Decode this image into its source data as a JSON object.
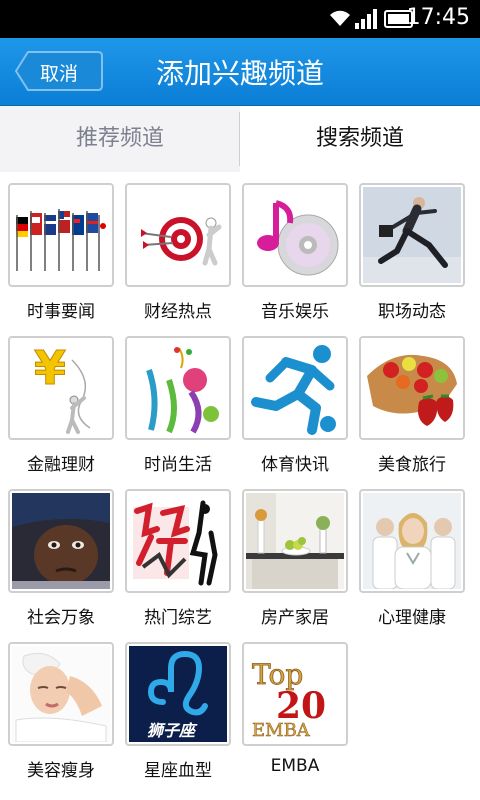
{
  "status_bar": {
    "time": "17:45",
    "icons": [
      "wifi-icon",
      "signal-icon",
      "battery-icon"
    ]
  },
  "header": {
    "back_label": "取消",
    "title": "添加兴趣频道"
  },
  "tabs": [
    {
      "label": "推荐频道",
      "selected": false
    },
    {
      "label": "搜索频道",
      "selected": true
    }
  ],
  "channels": [
    {
      "label": "时事要闻",
      "image": "flags-image"
    },
    {
      "label": "财经热点",
      "image": "target-image"
    },
    {
      "label": "音乐娱乐",
      "image": "music-cd-image"
    },
    {
      "label": "职场动态",
      "image": "businessman-jump-image"
    },
    {
      "label": "金融理财",
      "image": "yuan-sign-image"
    },
    {
      "label": "时尚生活",
      "image": "fashion-illustration-image"
    },
    {
      "label": "体育快讯",
      "image": "runner-icon-image"
    },
    {
      "label": "美食旅行",
      "image": "strawberry-cake-image"
    },
    {
      "label": "社会万象",
      "image": "child-face-image"
    },
    {
      "label": "热门综艺",
      "image": "variety-show-logo-image"
    },
    {
      "label": "房产家居",
      "image": "interior-image"
    },
    {
      "label": "心理健康",
      "image": "doctors-image"
    },
    {
      "label": "美容瘦身",
      "image": "facial-spa-image"
    },
    {
      "label": "星座血型",
      "image": "leo-zodiac-image",
      "image_text": "狮子座"
    },
    {
      "label": "EMBA",
      "image": "top20-emba-logo",
      "image_text": "Top 20 EMBA"
    }
  ],
  "colors": {
    "header": "#1589df",
    "tab_inactive_text": "#7d8090",
    "border": "#cfcfcf"
  }
}
